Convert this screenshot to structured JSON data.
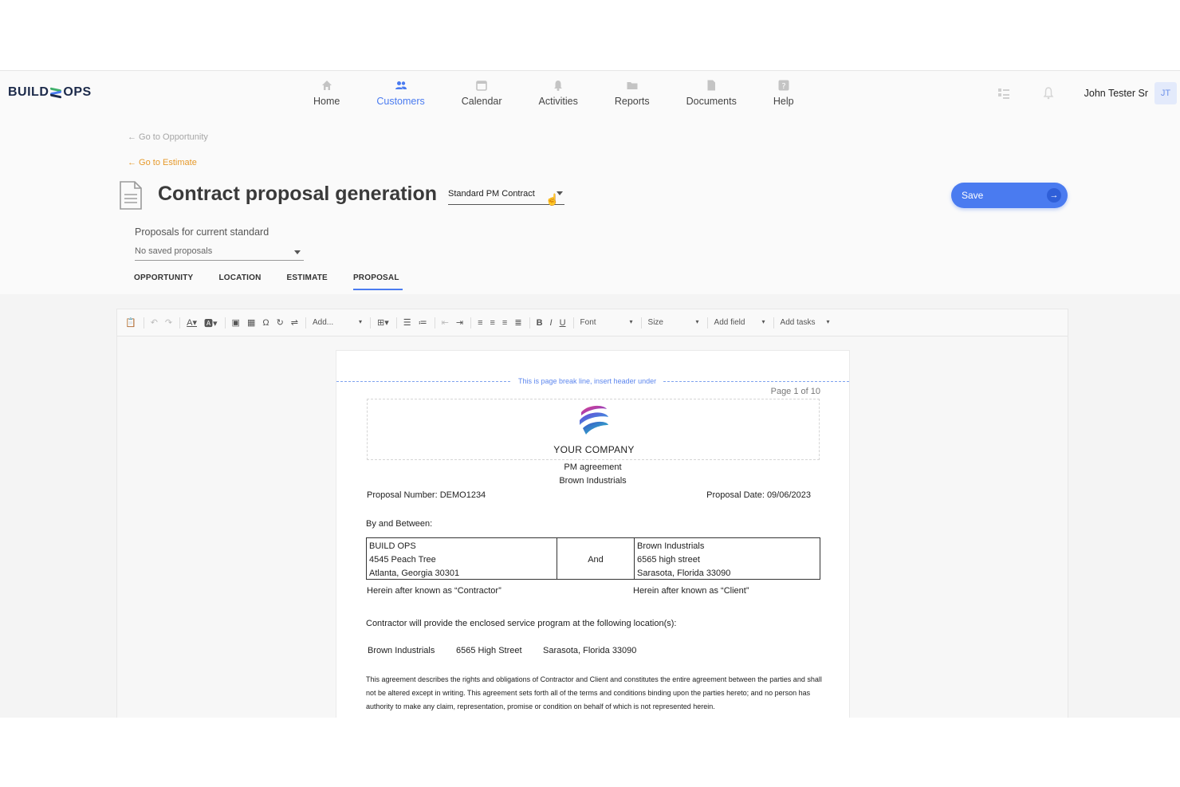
{
  "nav": {
    "logo_left": "BUILD",
    "logo_right": "OPS",
    "items": [
      {
        "label": "Home",
        "icon": "home-icon"
      },
      {
        "label": "Customers",
        "icon": "customers-icon"
      },
      {
        "label": "Calendar",
        "icon": "calendar-icon"
      },
      {
        "label": "Activities",
        "icon": "bell-icon"
      },
      {
        "label": "Reports",
        "icon": "folder-icon"
      },
      {
        "label": "Documents",
        "icon": "document-icon"
      },
      {
        "label": "Help",
        "icon": "help-icon"
      }
    ],
    "active": "Customers",
    "user_name": "John Tester Sr",
    "user_initials": "JT"
  },
  "header": {
    "back_opportunity": "← Go to Opportunity",
    "back_estimate": "← Go to Estimate",
    "title": "Contract proposal generation",
    "standard_value": "Standard PM Contract",
    "save_label": "Save",
    "proposals_label": "Proposals for current standard",
    "proposals_value": "No saved proposals"
  },
  "tabs": [
    "OPPORTUNITY",
    "LOCATION",
    "ESTIMATE",
    "PROPOSAL"
  ],
  "active_tab": "PROPOSAL",
  "toolbar": {
    "add_label": "Add...",
    "font_label": "Font",
    "size_label": "Size",
    "add_field_label": "Add field",
    "add_tasks_label": "Add tasks",
    "bold": "B",
    "italic": "I",
    "underline": "U"
  },
  "document": {
    "page_break_text": "This is page break line, insert header under",
    "page_number": "Page 1 of 10",
    "company_name": "YOUR COMPANY",
    "agreement_type": "PM agreement",
    "client_name": "Brown Industrials",
    "proposal_number": "Proposal Number:  DEMO1234",
    "proposal_date": "Proposal Date:  09/06/2023",
    "by_and_between": "By and Between:",
    "contractor": {
      "name": "BUILD OPS",
      "street": " 4545 Peach Tree",
      "city": "Atlanta, Georgia 30301"
    },
    "and_label": "And",
    "client": {
      "name": "Brown Industrials",
      "street": "6565 high street",
      "city": "Sarasota, Florida 33090"
    },
    "contractor_known": "Herein after known as “Contractor”",
    "client_known": "Herein after known as “Client”",
    "service_program": "Contractor will provide the enclosed service program at the following location(s):",
    "location_name": "Brown Industrials",
    "location_street": "6565 High Street",
    "location_city": "Sarasota, Florida 33090",
    "agreement_paragraph": "This agreement describes the rights and obligations of Contractor and Client and constitutes the entire agreement between the parties and shall not be altered except in writing.   This agreement sets forth all of the terms and conditions binding upon the parties hereto; and no person has authority to make any claim, representation, promise or condition on behalf of which is not represented herein."
  },
  "colors": {
    "accent": "#4a7bf0",
    "back_link_active": "#e69a2c"
  }
}
